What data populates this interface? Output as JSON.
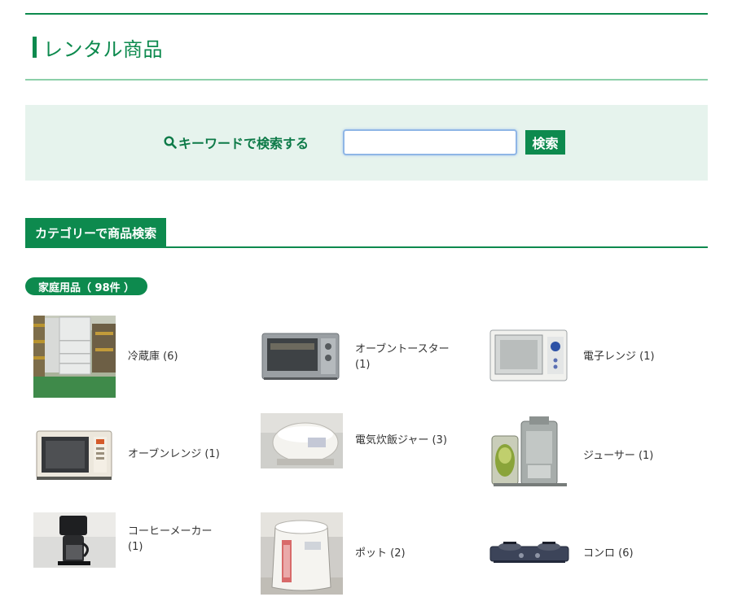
{
  "page": {
    "title": "レンタル商品"
  },
  "search": {
    "label": "キーワードで検索する",
    "input_value": "",
    "placeholder": "",
    "button_label": "検索"
  },
  "category": {
    "header": "カテゴリーで商品検索"
  },
  "group": {
    "badge": "家庭用品（ 98件 ）",
    "items": [
      {
        "label": "冷蔵庫 (6)",
        "icon": "refrigerator-image"
      },
      {
        "label": "オーブントースター (1)",
        "icon": "toaster-oven-image"
      },
      {
        "label": "電子レンジ (1)",
        "icon": "microwave-image"
      },
      {
        "label": "オーブンレンジ (1)",
        "icon": "oven-range-image"
      },
      {
        "label": "電気炊飯ジャー (3)",
        "icon": "rice-cooker-image"
      },
      {
        "label": "ジューサー (1)",
        "icon": "juicer-image"
      },
      {
        "label": "コーヒーメーカー (1)",
        "icon": "coffee-maker-image"
      },
      {
        "label": "ポット (2)",
        "icon": "electric-pot-image"
      },
      {
        "label": "コンロ (6)",
        "icon": "gas-stove-image"
      }
    ]
  },
  "colors": {
    "accent": "#0d8a4e",
    "panel_bg": "#e6f3ed"
  }
}
